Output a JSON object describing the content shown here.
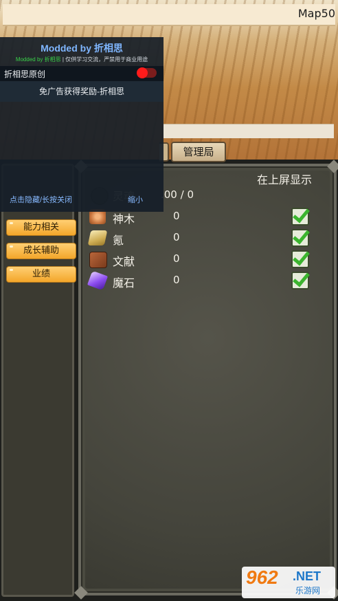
{
  "scene": {
    "map_label": "Map50"
  },
  "tabs": [
    {
      "label": "管理局"
    }
  ],
  "sidebar": {
    "items": [
      {
        "label": "能力相关"
      },
      {
        "label": "成长辅助"
      },
      {
        "label": "业绩"
      }
    ]
  },
  "panel": {
    "header": "在上屏显示",
    "partial_row": {
      "name": "灵魂",
      "value": ".00 / 0"
    },
    "rows": [
      {
        "name": "神木",
        "value": "0",
        "icon": "wood-icon",
        "checked": true
      },
      {
        "name": "氪",
        "value": "0",
        "icon": "gold-bar-icon",
        "checked": true
      },
      {
        "name": "文献",
        "value": "0",
        "icon": "book-icon",
        "checked": true
      },
      {
        "name": "魔石",
        "value": "0",
        "icon": "magic-stone-icon",
        "checked": true
      }
    ]
  },
  "mod_menu": {
    "title": "Modded by 折相思",
    "subtitle_green": "Modded by 折相思",
    "subtitle_white": "| 仅供学习交流，严禁用于商业用途",
    "toggle_label": "折相思原创",
    "toggle_on": true,
    "ad_label": "免广告获得奖励-折相思",
    "footer_left": "点击隐藏/长按关闭",
    "footer_right": "缩小"
  },
  "watermark": {
    "logo": "962",
    "net": ".NET",
    "cn": "乐游网"
  },
  "colors": {
    "accent_orange": "#f3a62a",
    "check_green": "#3bb52e",
    "mod_blue": "#7fb6ff",
    "toggle_red": "#ff1b1b"
  }
}
